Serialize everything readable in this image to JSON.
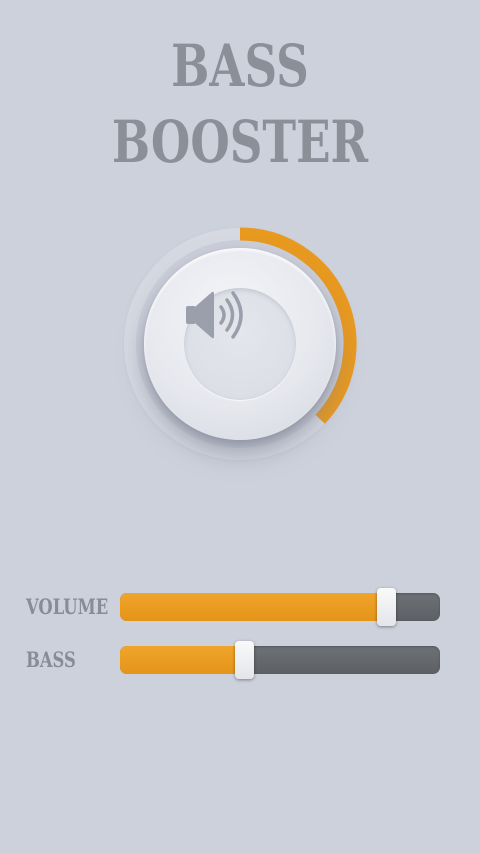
{
  "app": {
    "title": "BASS BOOSTER"
  },
  "colors": {
    "background": "#cdd1dc",
    "accent": "#e8991f",
    "track": "#656a6e",
    "title": "#8a8f98"
  },
  "knob": {
    "icon": "speaker-volume-icon",
    "level": 0.37
  },
  "sliders": {
    "volume": {
      "label": "VOLUME",
      "value": 0.835
    },
    "bass": {
      "label": "BASS",
      "value": 0.39
    }
  }
}
